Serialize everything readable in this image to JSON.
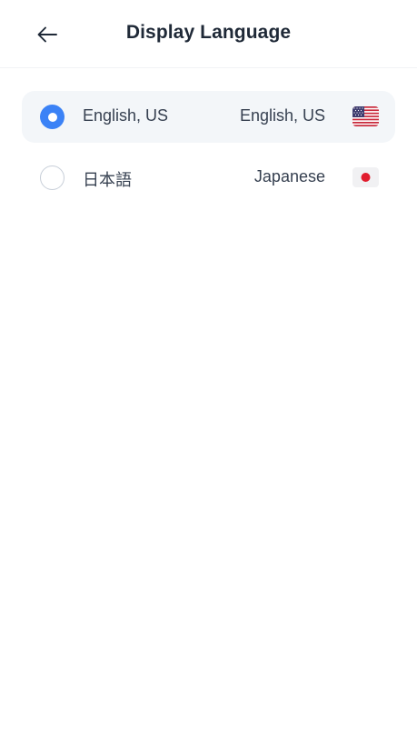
{
  "header": {
    "title": "Display Language",
    "back_icon": "arrow-left-icon"
  },
  "languages": [
    {
      "native": "English, US",
      "english": "English, US",
      "selected": true,
      "flag_icon": "us-flag-icon"
    },
    {
      "native": "日本語",
      "english": "Japanese",
      "selected": false,
      "flag_icon": "japan-flag-icon"
    }
  ],
  "colors": {
    "accent": "#3b82f6",
    "selected_row_bg": "#f3f6f9",
    "text": "#1f2937"
  }
}
